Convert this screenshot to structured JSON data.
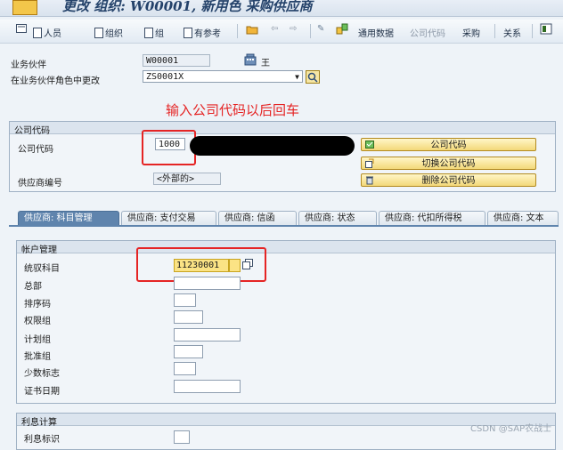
{
  "window": {
    "title": "更改 组织: W00001, 新用色 采购供应商"
  },
  "toolbar": {
    "items": [
      {
        "label": "人员"
      },
      {
        "label": "组织"
      },
      {
        "label": "组"
      },
      {
        "label": "有参考"
      },
      {
        "label": "通用数据"
      },
      {
        "label": "公司代码"
      },
      {
        "label": "采购"
      },
      {
        "label": "关系"
      }
    ]
  },
  "header": {
    "partner_label": "业务伙伴",
    "partner_value": "W00001",
    "partner_name": "王",
    "role_label": "在业务伙伴角色中更改",
    "role_value": "ZS0001X"
  },
  "annotation": "输入公司代码以后回车",
  "company": {
    "group_title": "公司代码",
    "code_label": "公司代码",
    "code_value": "1000",
    "vendor_label": "供应商编号",
    "vendor_value": "<外部的>",
    "btn_company": "公司代码",
    "btn_switch": "切换公司代码",
    "btn_delete": "删除公司代码"
  },
  "tabs": [
    {
      "label": "供应商: 科目管理"
    },
    {
      "label": "供应商: 支付交易"
    },
    {
      "label": "供应商: 信函"
    },
    {
      "label": "供应商: 状态"
    },
    {
      "label": "供应商: 代扣所得税"
    },
    {
      "label": "供应商: 文本"
    }
  ],
  "account": {
    "group_title": "帐户管理",
    "fields": [
      {
        "label": "统驭科目",
        "value": "11230001"
      },
      {
        "label": "总部",
        "value": ""
      },
      {
        "label": "排序码",
        "value": ""
      },
      {
        "label": "权限组",
        "value": ""
      },
      {
        "label": "计划组",
        "value": ""
      },
      {
        "label": "批准组",
        "value": ""
      },
      {
        "label": "少数标志",
        "value": ""
      },
      {
        "label": "证书日期",
        "value": ""
      }
    ]
  },
  "interest": {
    "group_title": "利息计算",
    "partial_label": "利息标识"
  },
  "watermark": "CSDN @SAP农战士"
}
